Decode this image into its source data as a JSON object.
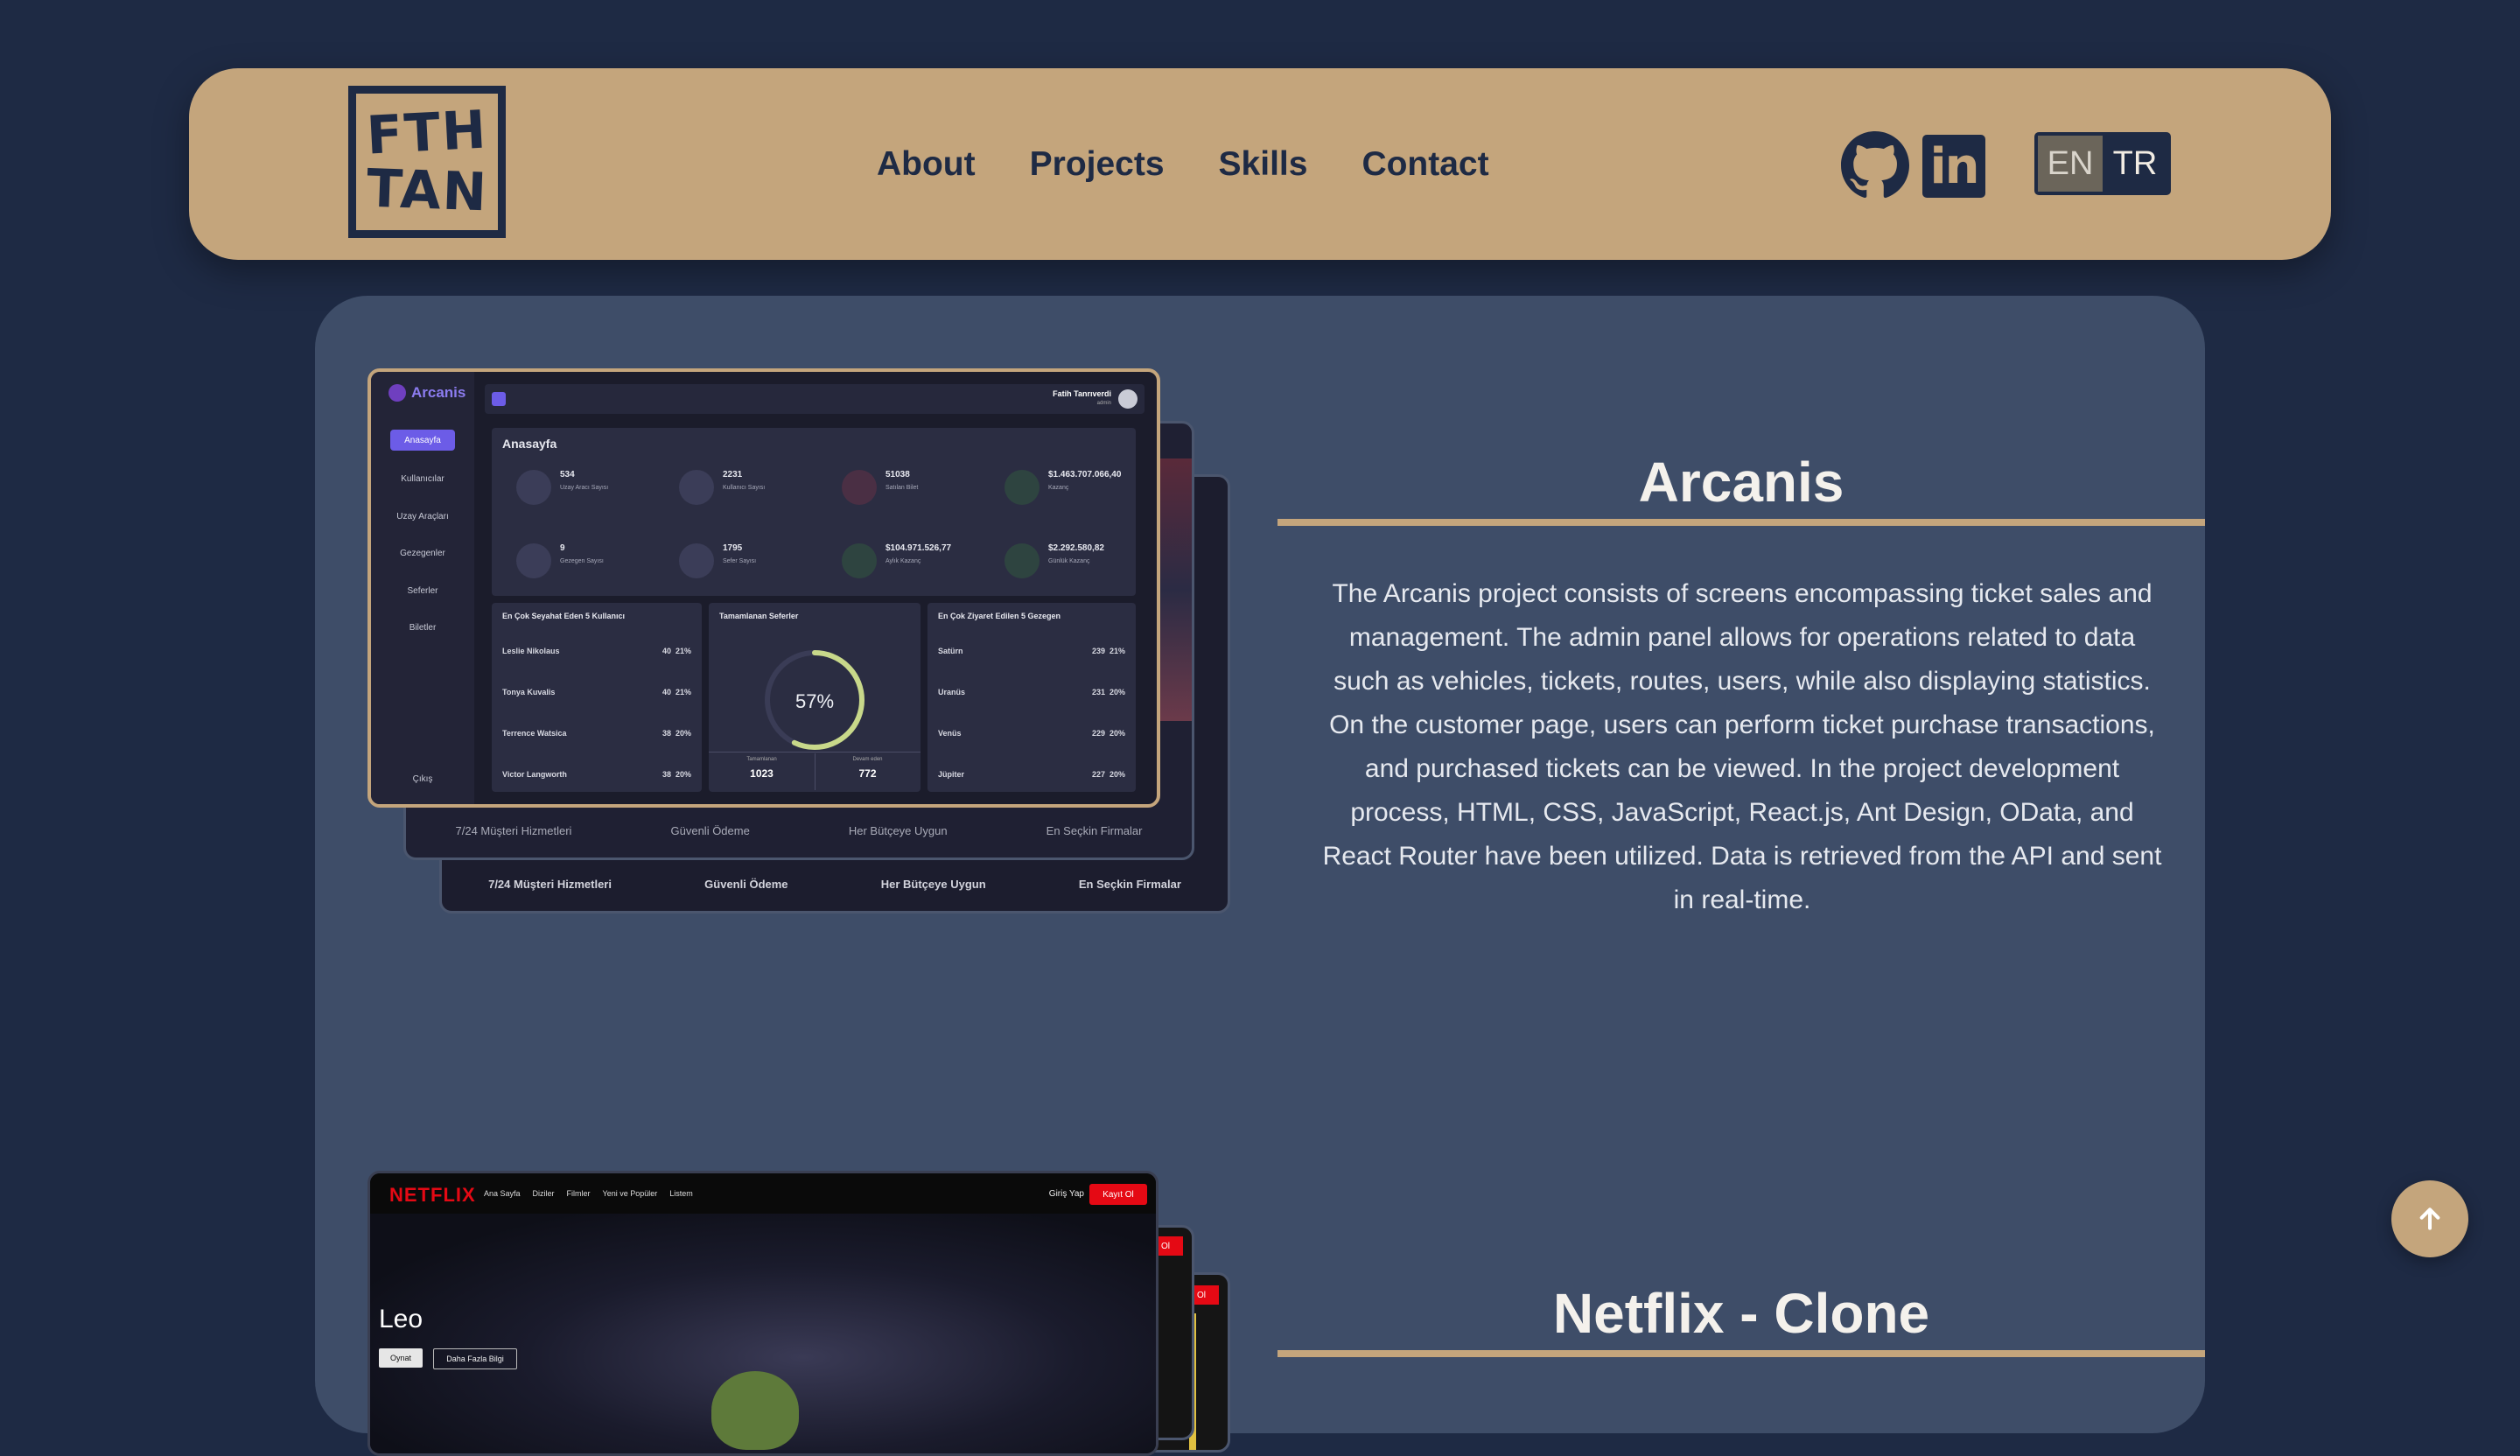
{
  "header": {
    "logo_line1": "FTH",
    "logo_line2": "TAN",
    "nav": [
      "About",
      "Projects",
      "Skills",
      "Contact"
    ],
    "social_icons": [
      "github-icon",
      "linkedin-icon"
    ],
    "linkedin_text": "in",
    "lang": {
      "en": "EN",
      "tr": "TR",
      "selected": "EN"
    }
  },
  "projects": [
    {
      "title": "Arcanis",
      "description": "The Arcanis project consists of screens encompassing ticket sales and management. The admin panel allows for operations related to data such as vehicles, tickets, routes, users, while also displaying statistics. On the customer page, users can perform ticket purchase transactions, and purchased tickets can be viewed. In the project development process, HTML, CSS, JavaScript, React.js, Ant Design, OData, and React Router have been utilized. Data is retrieved from the API and sent in real-time.",
      "screenshot": {
        "brand": "Arcanis",
        "user": "Fatih Tanrıverdi",
        "user_role": "admin",
        "sidebar": [
          "Anasayfa",
          "Kullanıcılar",
          "Uzay Araçları",
          "Gezegenler",
          "Seferler",
          "Biletler"
        ],
        "logout": "Çıkış",
        "page_title": "Anasayfa",
        "stats": [
          {
            "value": "534",
            "label": "Uzay Aracı Sayısı"
          },
          {
            "value": "2231",
            "label": "Kullanıcı Sayısı"
          },
          {
            "value": "51038",
            "label": "Satılan Bilet"
          },
          {
            "value": "$1.463.707.066,40",
            "label": "Kazanç"
          },
          {
            "value": "9",
            "label": "Gezegen Sayısı"
          },
          {
            "value": "1795",
            "label": "Sefer Sayısı"
          },
          {
            "value": "$104.971.526,77",
            "label": "Aylık Kazanç"
          },
          {
            "value": "$2.292.580,82",
            "label": "Günlük Kazanç"
          }
        ],
        "top_users_title": "En Çok Seyahat Eden 5 Kullanıcı",
        "top_users": [
          {
            "name": "Leslie Nikolaus",
            "count": "40",
            "pct": "21%"
          },
          {
            "name": "Tonya Kuvalis",
            "count": "40",
            "pct": "21%"
          },
          {
            "name": "Terrence Watsica",
            "count": "38",
            "pct": "20%"
          },
          {
            "name": "Victor Langworth",
            "count": "38",
            "pct": "20%"
          }
        ],
        "completed_title": "Tamamlanan Seferler",
        "completed_pct": "57%",
        "completed_pct_value": 0.57,
        "completed_label": "Tamamlanan",
        "completed_count": "1023",
        "remaining_label": "Devam eden",
        "remaining_count": "772",
        "top_planets_title": "En Çok Ziyaret Edilen 5 Gezegen",
        "top_planets": [
          {
            "name": "Satürn",
            "count": "239",
            "pct": "21%"
          },
          {
            "name": "Uranüs",
            "count": "231",
            "pct": "20%"
          },
          {
            "name": "Venüs",
            "count": "229",
            "pct": "20%"
          },
          {
            "name": "Jüpiter",
            "count": "227",
            "pct": "20%"
          }
        ],
        "features": [
          "7/24 Müşteri Hizmetleri",
          "Güvenli Ödeme",
          "Her Bütçeye Uygun",
          "En Seçkin Firmalar"
        ]
      }
    },
    {
      "title": "Netflix - Clone",
      "screenshot": {
        "logo": "NETFLIX",
        "menu": [
          "Ana Sayfa",
          "Diziler",
          "Filmler",
          "Yeni ve Popüler",
          "Listem"
        ],
        "login": "Giriş Yap",
        "signup": "Kayıt Ol",
        "signup_short": "Ol",
        "movie": "Leo",
        "play": "Oynat",
        "more": "Daha Fazla Bilgi"
      }
    }
  ],
  "colors": {
    "accent": "#c4a57c",
    "background": "#1e2a44",
    "card": "#3e4d68"
  },
  "scroll_top_icon": "arrow-up-icon"
}
